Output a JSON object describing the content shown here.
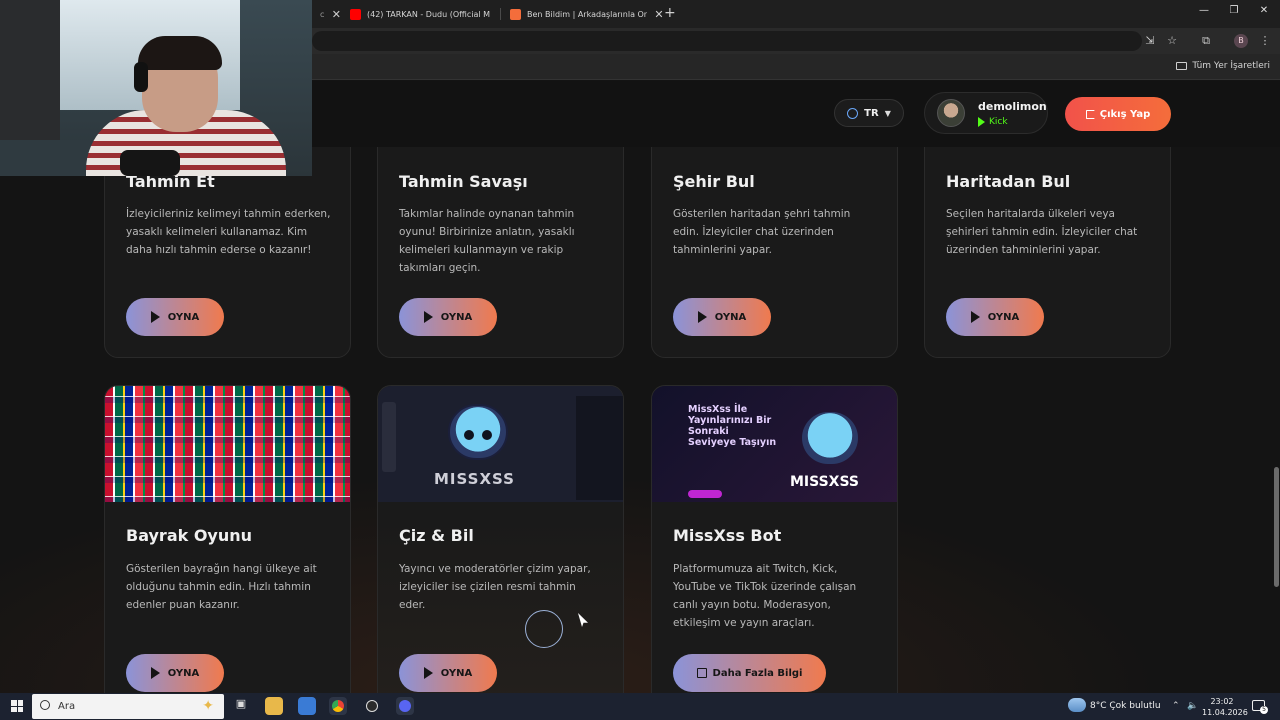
{
  "browser": {
    "tabs": [
      {
        "title": "(42) TARKAN - Dudu (Official M",
        "favicon_color": "#ff0000"
      },
      {
        "title": "Ben Bildim | Arkadaşlarınla Onl",
        "favicon_color": "#f46d3b"
      }
    ],
    "new_tab_label": "+",
    "bookmarks_all": "Tüm Yer İşaretleri",
    "profile_initial": "B"
  },
  "header": {
    "lang": "TR",
    "user": {
      "name": "demolimon",
      "platform": "Kick"
    },
    "logout_label": "Çıkış Yap"
  },
  "games_row1": [
    {
      "title": "Tahmin Et",
      "description": "İzleyicileriniz kelimeyi tahmin ederken, yasaklı kelimeleri kullanamaz. Kim daha hızlı tahmin ederse o kazanır!",
      "button": "OYNA"
    },
    {
      "title": "Tahmin Savaşı",
      "description": "Takımlar halinde oynanan tahmin oyunu! Birbirinize anlatın, yasaklı kelimeleri kullanmayın ve rakip takımları geçin.",
      "button": "OYNA"
    },
    {
      "title": "Şehir Bul",
      "description": "Gösterilen haritadan şehri tahmin edin. İzleyiciler chat üzerinden tahminlerini yapar.",
      "button": "OYNA"
    },
    {
      "title": "Haritadan Bul",
      "description": "Seçilen haritalarda ülkeleri veya şehirleri tahmin edin. İzleyiciler chat üzerinden tahminlerini yapar.",
      "button": "OYNA"
    }
  ],
  "games_row2": [
    {
      "title": "Bayrak Oyunu",
      "description": "Gösterilen bayrağın hangi ülkeye ait olduğunu tahmin edin. Hızlı tahmin edenler puan kazanır.",
      "button": "OYNA"
    },
    {
      "title": "Çiz & Bil",
      "description": "Yayıncı ve moderatörler çizim yapar, izleyiciler ise çizilen resmi tahmin eder.",
      "button": "OYNA",
      "thumb_text": "MISSXSS"
    },
    {
      "title": "MissXss Bot",
      "description": "Platformumuza ait Twitch, Kick, YouTube ve TikTok üzerinde çalışan canlı yayın botu. Moderasyon, etkileşim ve yayın araçları.",
      "button": "Daha Fazla Bilgi",
      "thumb_headline": "MissXss İle Yayınlarınızı Bir Sonraki Seviyeye Taşıyın",
      "thumb_name": "MISSXSS"
    }
  ],
  "taskbar": {
    "search_placeholder": "Ara",
    "weather": "8°C  Çok bulutlu",
    "time": "23:02",
    "date": "11.04.2026",
    "notifications": "5"
  },
  "colors": {
    "accent_gradient_start": "#8b93d8",
    "accent_gradient_end": "#f07a4e",
    "logout": "#f2524a",
    "kick": "#53fc18"
  }
}
